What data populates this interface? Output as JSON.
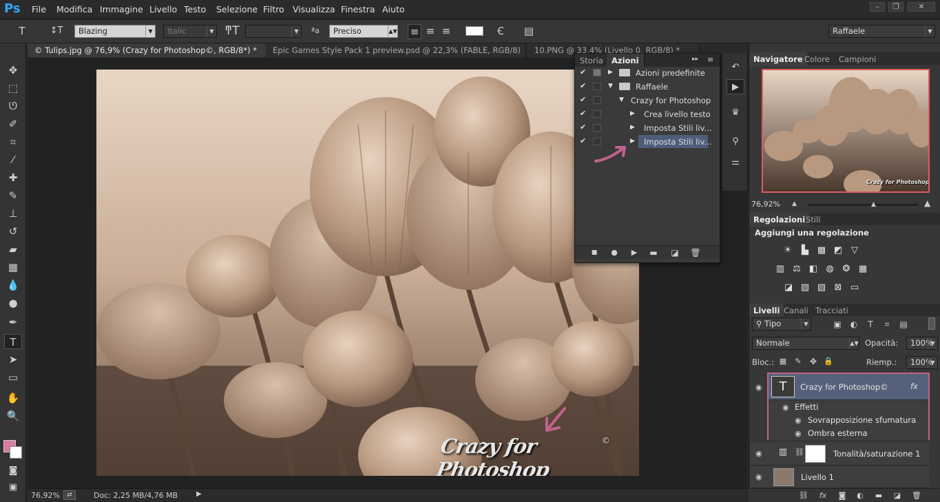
{
  "app": {
    "logo": "Ps"
  },
  "menu": [
    "File",
    "Modifica",
    "Immagine",
    "Livello",
    "Testo",
    "Selezione",
    "Filtro",
    "Visualizza",
    "Finestra",
    "Aiuto"
  ],
  "options": {
    "font_family": "Blazing",
    "font_style": "Italic",
    "font_size": "",
    "antialias": "Preciso",
    "workspace": "Raffaele"
  },
  "tabs": [
    "© Tulips.jpg @ 76,9% (Crazy for Photoshop©, RGB/8*) *",
    "Epic Games Style Pack 1 preview.psd @ 22,3% (FABLE, RGB/8)",
    "10.PNG @ 33,4% (Livello 0, RGB/8) *"
  ],
  "canvas": {
    "watermark": "Crazy for Photoshop",
    "copyright": "©"
  },
  "status": {
    "zoom": "76,92%",
    "doc": "Doc: 2,25 MB/4,76 MB"
  },
  "actions_panel": {
    "tabs": [
      "Storia",
      "Azioni"
    ],
    "rows": [
      {
        "label": "Azioni predefinite"
      },
      {
        "label": "Raffaele"
      },
      {
        "label": "Crazy for Photoshop"
      },
      {
        "label": "Crea livello testo"
      },
      {
        "label": "Imposta Stili liv..."
      },
      {
        "label": "Imposta Stili liv..."
      }
    ]
  },
  "navigator": {
    "tabs": [
      "Navigatore",
      "Colore",
      "Campioni"
    ],
    "zoom": "76,92%",
    "slider_level": 0.6,
    "thumb_watermark": "Crazy for Photoshop"
  },
  "adjustments": {
    "tabs": [
      "Regolazioni",
      "Stili"
    ],
    "heading": "Aggiungi una regolazione"
  },
  "layers": {
    "tabs": [
      "Livelli",
      "Canali",
      "Tracciati"
    ],
    "filter": "Tipo",
    "blend_mode": "Normale",
    "opacity_label": "Opacità:",
    "opacity": "100%",
    "lock_label": "Bloc.:",
    "fill_label": "Riemp.:",
    "fill": "100%",
    "items": [
      {
        "name": "Crazy for Photoshop©",
        "fx": "fx"
      },
      {
        "name": "Effetti"
      },
      {
        "name": "Sovrapposizione sfumatura"
      },
      {
        "name": "Ombra esterna"
      },
      {
        "name": "Tonalità/saturazione 1"
      },
      {
        "name": "Livello 1"
      }
    ]
  },
  "colors": {
    "accent_pink": "#c2638e",
    "foreground": "#d97aa0",
    "background": "#ffffff",
    "sepia": "#b4967e"
  }
}
